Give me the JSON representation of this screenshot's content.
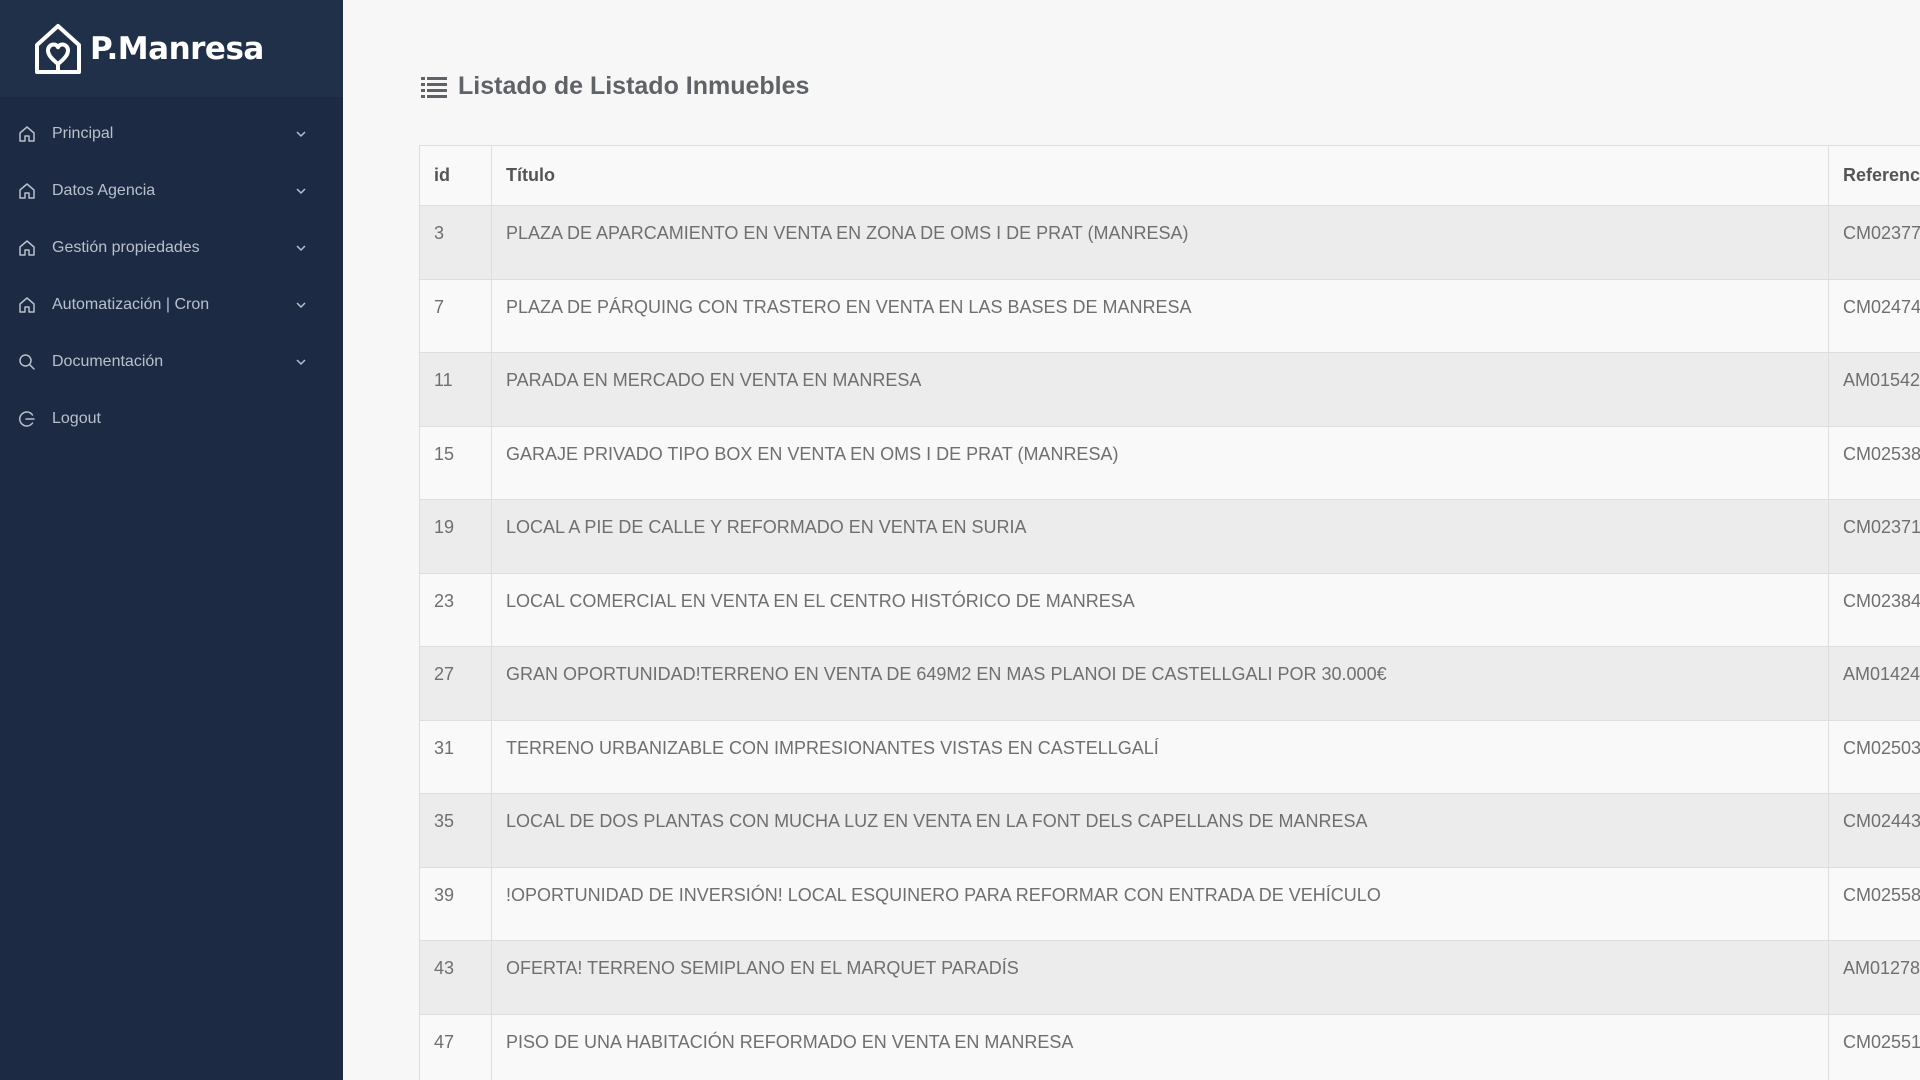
{
  "brand": {
    "name": "P.Manresa"
  },
  "nav": [
    {
      "label": "Principal",
      "icon": "home-icon",
      "has_chevron": true
    },
    {
      "label": "Datos Agencia",
      "icon": "home-icon",
      "has_chevron": true
    },
    {
      "label": "Gestión propiedades",
      "icon": "home-icon",
      "has_chevron": true
    },
    {
      "label": "Automatización | Cron",
      "icon": "home-icon",
      "has_chevron": true
    },
    {
      "label": "Documentación",
      "icon": "search-icon",
      "has_chevron": true
    },
    {
      "label": "Logout",
      "icon": "logout-icon",
      "has_chevron": false
    }
  ],
  "page": {
    "title": "Listado de Listado Inmuebles"
  },
  "table": {
    "columns": [
      "id",
      "Título",
      "Referencia"
    ],
    "rows": [
      {
        "id": "3",
        "titulo": "PLAZA DE APARCAMIENTO EN VENTA EN ZONA DE OMS I DE PRAT (MANRESA)",
        "referencia": "CM02377"
      },
      {
        "id": "7",
        "titulo": "PLAZA DE PÁRQUING CON TRASTERO EN VENTA EN LAS BASES DE MANRESA",
        "referencia": "CM02474"
      },
      {
        "id": "11",
        "titulo": "PARADA EN MERCADO EN VENTA EN MANRESA",
        "referencia": "AM01542"
      },
      {
        "id": "15",
        "titulo": "GARAJE PRIVADO TIPO BOX EN VENTA EN OMS I DE PRAT (MANRESA)",
        "referencia": "CM02538"
      },
      {
        "id": "19",
        "titulo": "LOCAL A PIE DE CALLE Y REFORMADO EN VENTA EN SURIA",
        "referencia": "CM02371"
      },
      {
        "id": "23",
        "titulo": "LOCAL COMERCIAL EN VENTA EN EL CENTRO HISTÓRICO DE MANRESA",
        "referencia": "CM02384"
      },
      {
        "id": "27",
        "titulo": "GRAN OPORTUNIDAD!TERRENO EN VENTA DE 649M2 EN MAS PLANOI DE CASTELLGALI POR 30.000€",
        "referencia": "AM01424"
      },
      {
        "id": "31",
        "titulo": "TERRENO URBANIZABLE CON IMPRESIONANTES VISTAS EN CASTELLGALÍ",
        "referencia": "CM02503"
      },
      {
        "id": "35",
        "titulo": "LOCAL DE DOS PLANTAS CON MUCHA LUZ EN VENTA EN LA FONT DELS CAPELLANS DE MANRESA",
        "referencia": "CM02443"
      },
      {
        "id": "39",
        "titulo": "!OPORTUNIDAD DE INVERSIÓN! LOCAL ESQUINERO PARA REFORMAR CON ENTRADA DE VEHÍCULO",
        "referencia": "CM02558"
      },
      {
        "id": "43",
        "titulo": "OFERTA! TERRENO SEMIPLANO EN EL MARQUET PARADÍS",
        "referencia": "AM01278"
      },
      {
        "id": "47",
        "titulo": "PISO DE UNA HABITACIÓN REFORMADO EN VENTA EN MANRESA",
        "referencia": "CM02551"
      }
    ]
  }
}
